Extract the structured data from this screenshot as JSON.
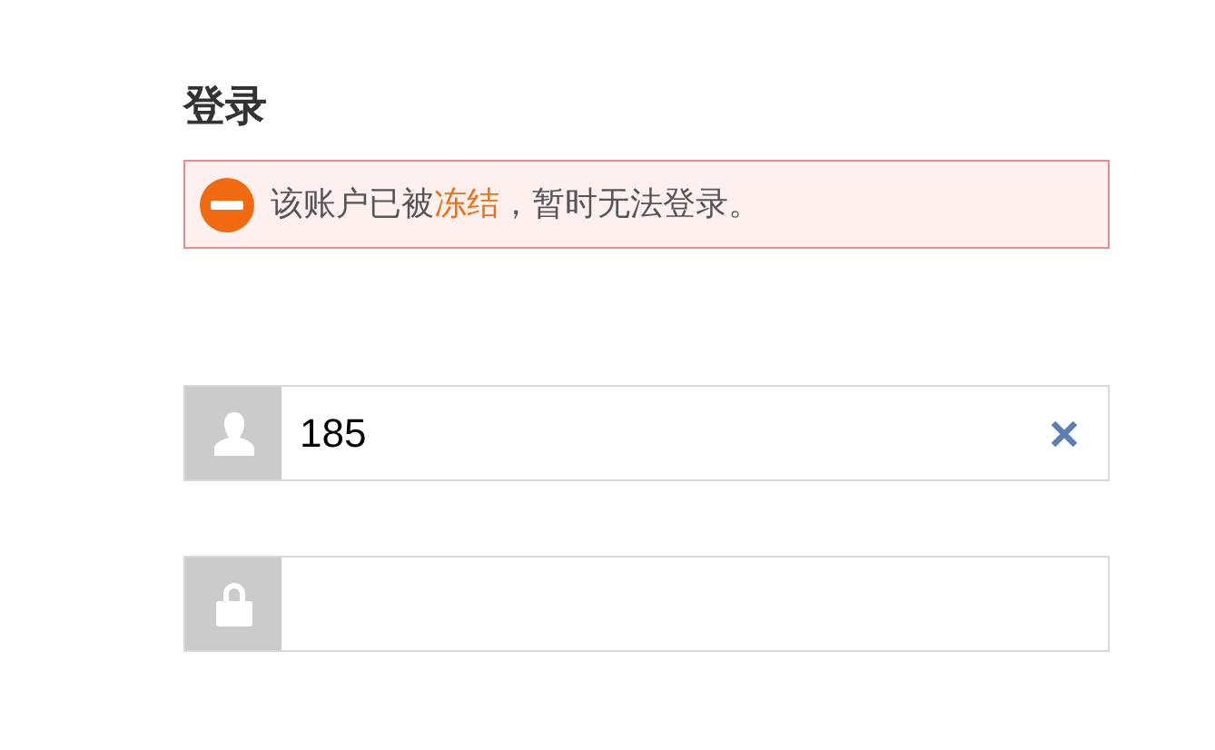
{
  "title": "登录",
  "error": {
    "parts": [
      {
        "text": "该账户已被",
        "highlight": false
      },
      {
        "text": "冻结",
        "highlight": true
      },
      {
        "text": "，暂时无法登录。",
        "highlight": false
      }
    ]
  },
  "fields": [
    {
      "kind": "user",
      "value": "185",
      "clearable": true
    },
    {
      "kind": "password",
      "clearable": false
    }
  ]
}
